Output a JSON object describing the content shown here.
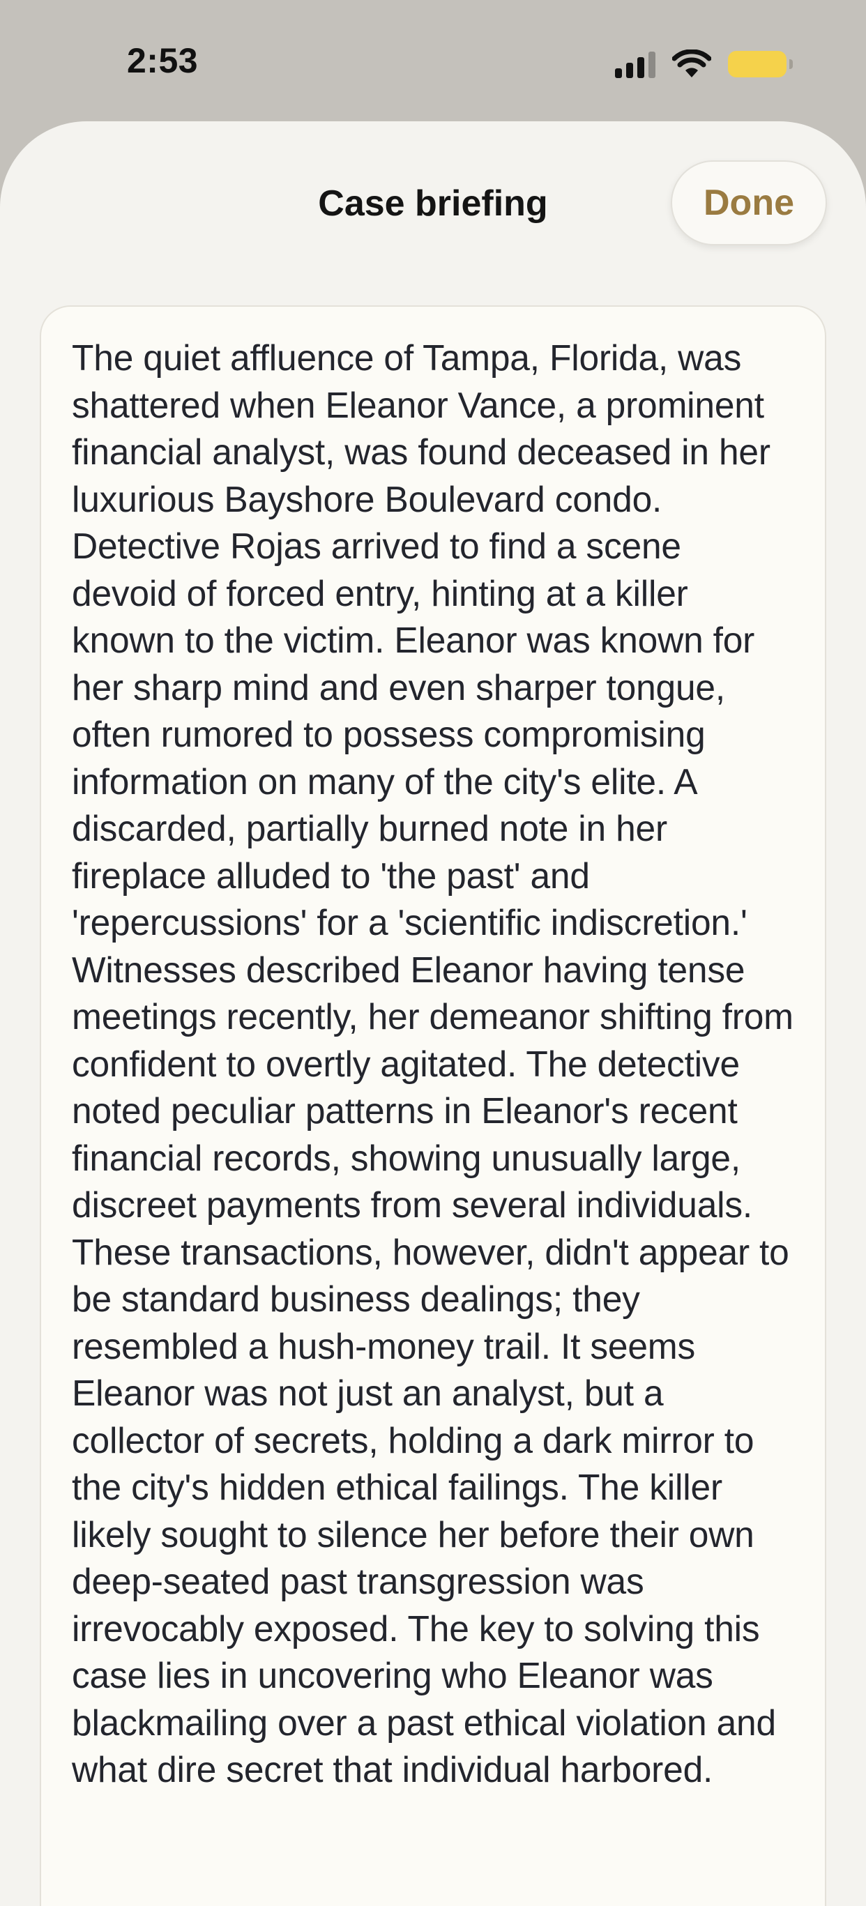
{
  "status_bar": {
    "time": "2:53",
    "icons": [
      "cellular-signal-icon",
      "wifi-icon",
      "battery-icon"
    ],
    "battery_color": "#f5d24b"
  },
  "sheet": {
    "title": "Case briefing",
    "done_label": "Done",
    "accent_color": "#9a7b41"
  },
  "briefing": {
    "text": "The quiet affluence of Tampa, Florida, was shattered when Eleanor Vance, a prominent financial analyst, was found deceased in her luxurious Bayshore Boulevard condo. Detective Rojas arrived to find a scene devoid of forced entry, hinting at a killer known to the victim. Eleanor was known for her sharp mind and even sharper tongue, often rumored to possess compromising information on many of the city's elite. A discarded, partially burned note in her fireplace alluded to 'the past' and 'repercussions' for a 'scientific indiscretion.' Witnesses described Eleanor having tense meetings recently, her demeanor shifting from confident to overtly agitated. The detective noted peculiar patterns in Eleanor's recent financial records, showing unusually large, discreet payments from several individuals. These transactions, however, didn't appear to be standard business dealings; they resembled a hush-money trail. It seems Eleanor was not just an analyst, but a collector of secrets, holding a dark mirror to the city's hidden ethical failings. The killer likely sought to silence her before their own deep-seated past transgression was irrevocably exposed. The key to solving this case lies in uncovering who Eleanor was blackmailing over a past ethical violation and what dire secret that individual harbored."
  }
}
